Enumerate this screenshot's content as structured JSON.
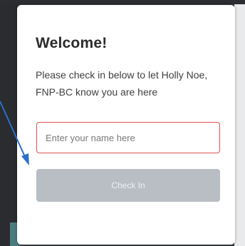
{
  "modal": {
    "title": "Welcome!",
    "message": "Please check in below to let Holly Noe, FNP-BC know you are here",
    "name_input": {
      "value": "",
      "placeholder": "Enter your name here"
    },
    "checkin_button_label": "Check In"
  },
  "colors": {
    "input_border": "#d9534f",
    "button_background": "#b9bdc4",
    "annotation_arrow": "#2a6fc9"
  },
  "icons": {
    "annotation": "arrow-icon"
  }
}
